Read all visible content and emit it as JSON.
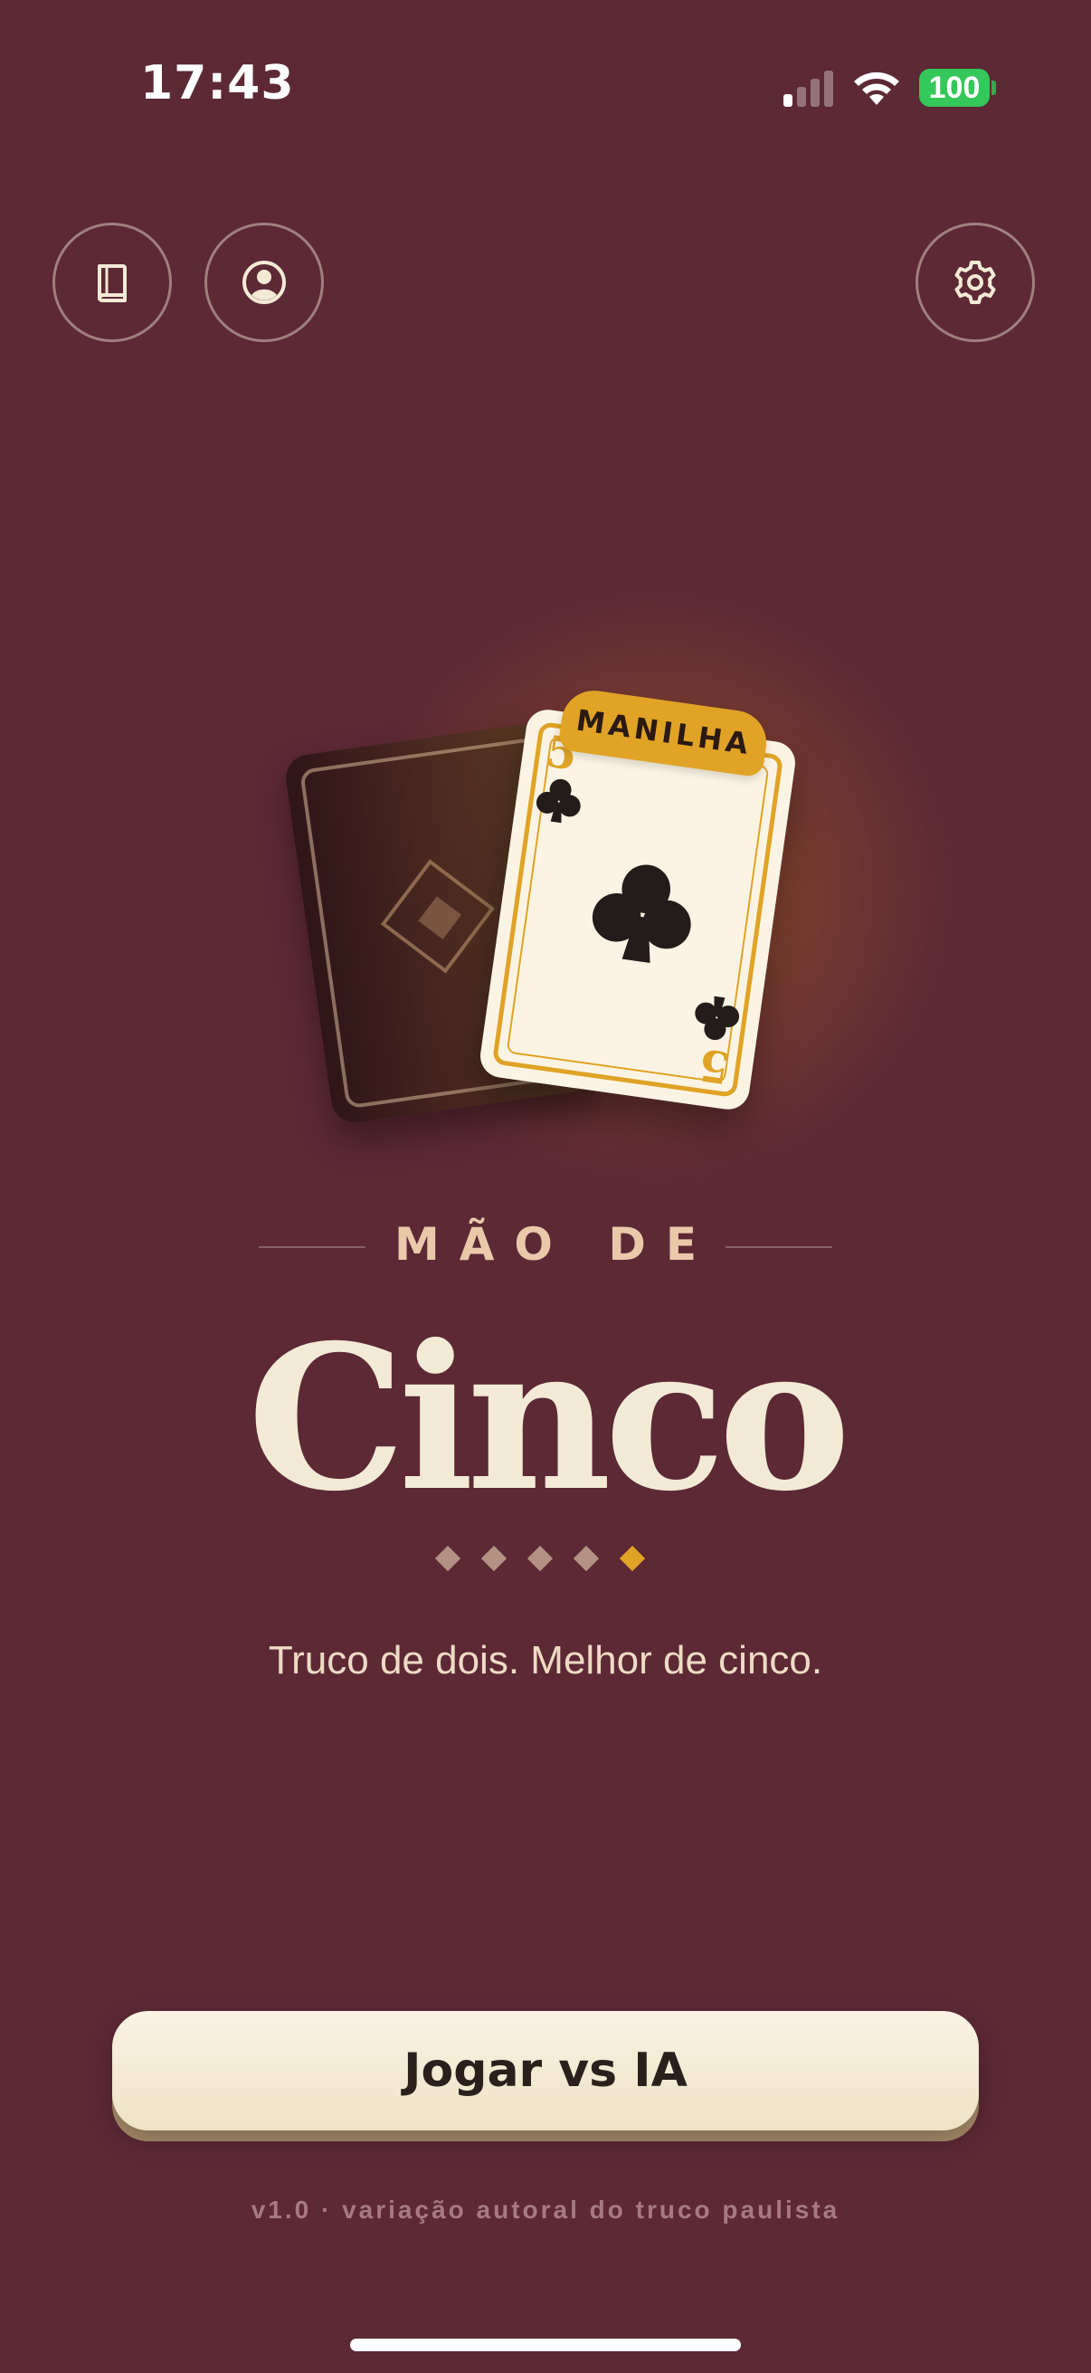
{
  "status_bar": {
    "time": "17:43",
    "battery": "100",
    "icons": [
      "cellular-signal-icon",
      "wifi-icon",
      "battery-icon"
    ]
  },
  "toolbar": {
    "left_buttons": [
      "book-icon",
      "profile-icon"
    ],
    "right_buttons": [
      "gear-icon"
    ]
  },
  "hero": {
    "badge": "MANILHA",
    "card_rank": "5",
    "card_suit": "club-icon"
  },
  "title": {
    "subtitle": "MÃO DE",
    "main": "Cinco",
    "dots": {
      "total": 5,
      "active_index": 4
    }
  },
  "tagline": "Truco de dois. Melhor de cinco.",
  "actions": {
    "play_label": "Jogar vs IA"
  },
  "footer": {
    "version": "v1.0 · variação autoral do truco paulista"
  },
  "colors": {
    "background": "#5c2935",
    "accent": "#e0a325",
    "cream": "#f3ead6",
    "battery": "#34c759"
  }
}
